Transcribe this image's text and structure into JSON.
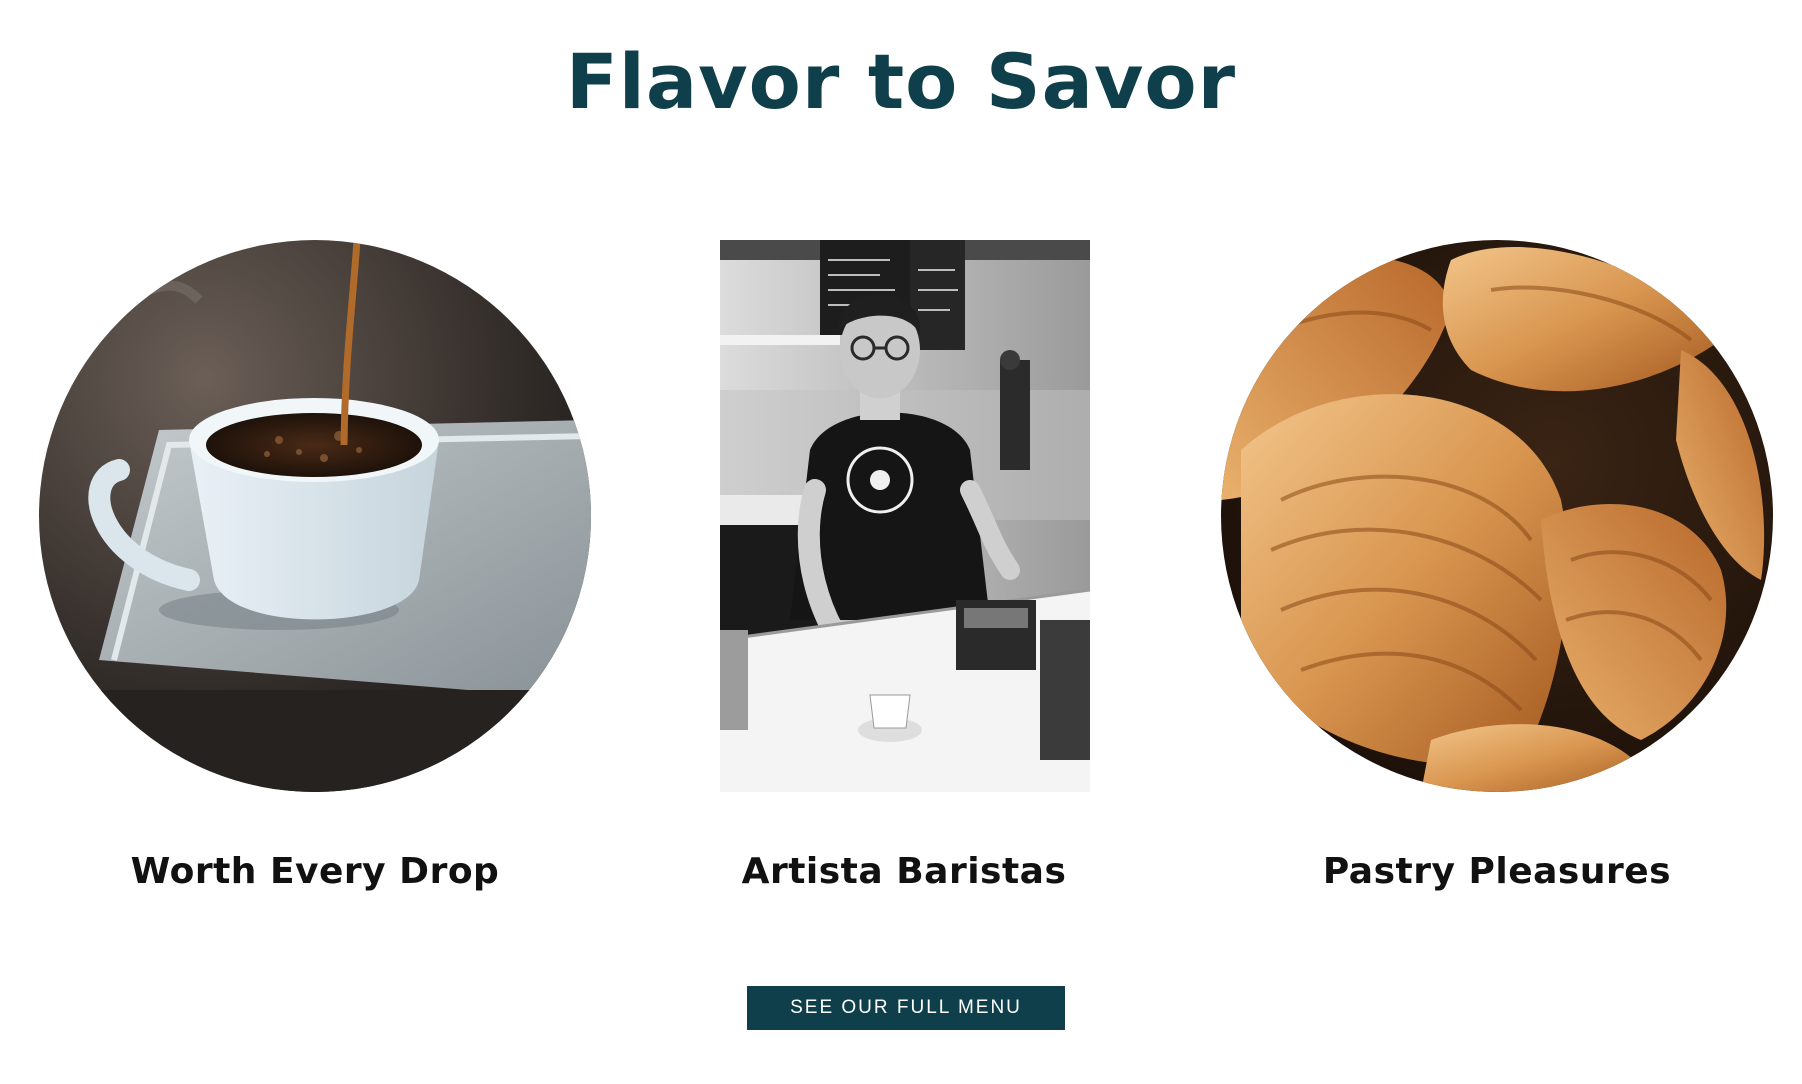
{
  "section": {
    "title": "Flavor to Savor"
  },
  "features": [
    {
      "title": "Worth Every Drop",
      "image": "coffee-cup-pour-photo"
    },
    {
      "title": "Artista Baristas",
      "image": "barista-photo"
    },
    {
      "title": "Pastry Pleasures",
      "image": "croissants-photo"
    }
  ],
  "cta": {
    "label": "SEE OUR FULL MENU"
  },
  "colors": {
    "brand": "#0f3f4b",
    "text": "#111111",
    "background": "#ffffff"
  }
}
